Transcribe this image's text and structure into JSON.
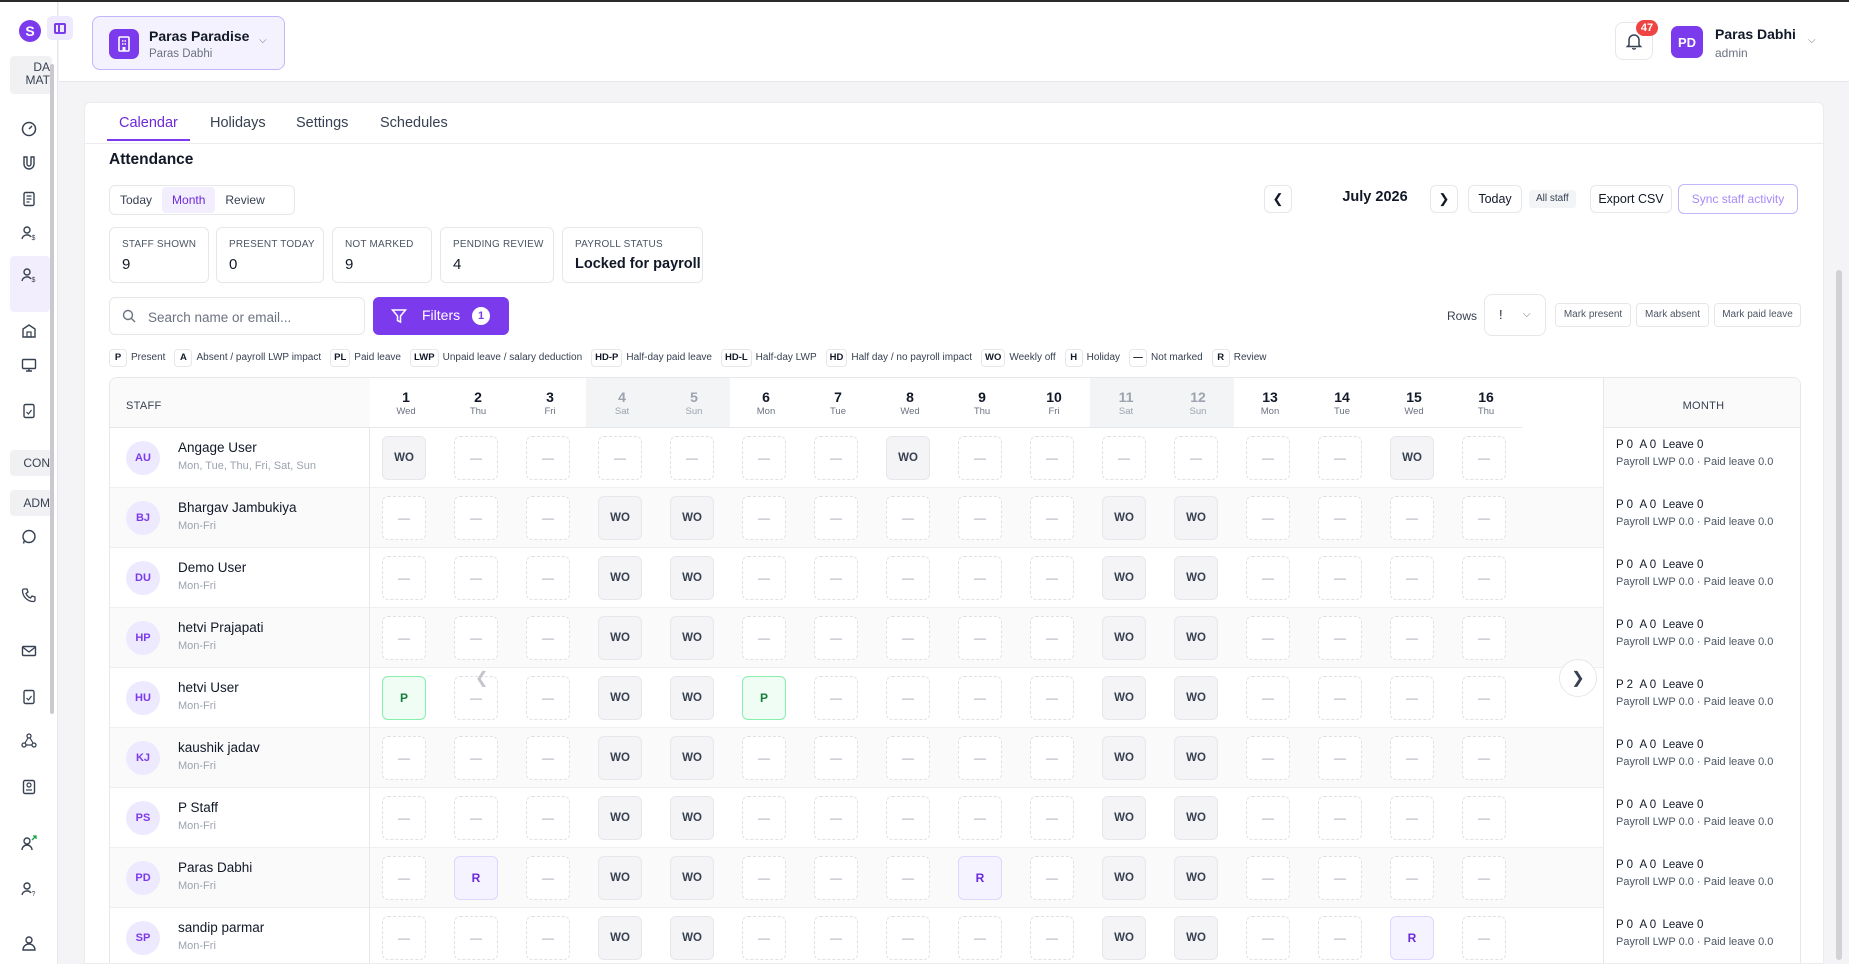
{
  "property": {
    "name": "Paras Paradise",
    "owner": "Paras Dabhi"
  },
  "user": {
    "initials": "PD",
    "name": "Paras Dabhi",
    "role": "admin",
    "notifications": "47"
  },
  "sidebar": {
    "logo": "S",
    "groups": [
      "DA MAT",
      "CON",
      "ADM"
    ]
  },
  "tabs": [
    "Calendar",
    "Holidays",
    "Settings",
    "Schedules"
  ],
  "title": "Attendance",
  "view_modes": [
    "Today",
    "Month",
    "Review"
  ],
  "stats": [
    {
      "label": "STAFF SHOWN",
      "value": "9"
    },
    {
      "label": "PRESENT TODAY",
      "value": "0"
    },
    {
      "label": "NOT MARKED",
      "value": "9"
    },
    {
      "label": "PENDING REVIEW",
      "value": "4"
    },
    {
      "label": "PAYROLL STATUS",
      "value": "Locked for payroll"
    }
  ],
  "calendar_nav": {
    "month": "July 2026",
    "today": "Today",
    "all_staff": "All staff",
    "export": "Export CSV",
    "sync": "Sync staff activity"
  },
  "search": {
    "placeholder": "Search name or email..."
  },
  "filters": {
    "label": "Filters",
    "count": "1"
  },
  "rows": {
    "label": "Rows",
    "value": "!"
  },
  "mark_buttons": [
    "Mark present",
    "Mark absent",
    "Mark paid leave"
  ],
  "legend": [
    {
      "code": "P",
      "text": "Present"
    },
    {
      "code": "A",
      "text": "Absent / payroll LWP impact"
    },
    {
      "code": "PL",
      "text": "Paid leave"
    },
    {
      "code": "LWP",
      "text": "Unpaid leave / salary deduction"
    },
    {
      "code": "HD-P",
      "text": "Half-day paid leave"
    },
    {
      "code": "HD-L",
      "text": "Half-day LWP"
    },
    {
      "code": "HD",
      "text": "Half day / no payroll impact"
    },
    {
      "code": "WO",
      "text": "Weekly off"
    },
    {
      "code": "H",
      "text": "Holiday"
    },
    {
      "code": "—",
      "text": "Not marked"
    },
    {
      "code": "R",
      "text": "Review"
    }
  ],
  "grid": {
    "staff_header": "STAFF",
    "month_header": "MONTH",
    "days": [
      {
        "n": "1",
        "w": "Wed"
      },
      {
        "n": "2",
        "w": "Thu"
      },
      {
        "n": "3",
        "w": "Fri"
      },
      {
        "n": "4",
        "w": "Sat"
      },
      {
        "n": "5",
        "w": "Sun"
      },
      {
        "n": "6",
        "w": "Mon"
      },
      {
        "n": "7",
        "w": "Tue"
      },
      {
        "n": "8",
        "w": "Wed"
      },
      {
        "n": "9",
        "w": "Thu"
      },
      {
        "n": "10",
        "w": "Fri"
      },
      {
        "n": "11",
        "w": "Sat"
      },
      {
        "n": "12",
        "w": "Sun"
      },
      {
        "n": "13",
        "w": "Mon"
      },
      {
        "n": "14",
        "w": "Tue"
      },
      {
        "n": "15",
        "w": "Wed"
      },
      {
        "n": "16",
        "w": "Thu"
      }
    ],
    "staff": [
      {
        "initials": "AU",
        "name": "Angage User",
        "schedule": "Mon, Tue, Thu, Fri, Sat, Sun",
        "cells": [
          "WO",
          "—",
          "—",
          "—",
          "—",
          "—",
          "—",
          "WO",
          "—",
          "—",
          "—",
          "—",
          "—",
          "—",
          "WO",
          "—"
        ],
        "p": "0",
        "a": "0",
        "leave": "0",
        "payroll_lwp": "0.0",
        "paid_leave": "0.0"
      },
      {
        "initials": "BJ",
        "name": "Bhargav Jambukiya",
        "schedule": "Mon-Fri",
        "cells": [
          "—",
          "—",
          "—",
          "WO",
          "WO",
          "—",
          "—",
          "—",
          "—",
          "—",
          "WO",
          "WO",
          "—",
          "—",
          "—",
          "—"
        ],
        "p": "0",
        "a": "0",
        "leave": "0",
        "payroll_lwp": "0.0",
        "paid_leave": "0.0"
      },
      {
        "initials": "DU",
        "name": "Demo User",
        "schedule": "Mon-Fri",
        "cells": [
          "—",
          "—",
          "—",
          "WO",
          "WO",
          "—",
          "—",
          "—",
          "—",
          "—",
          "WO",
          "WO",
          "—",
          "—",
          "—",
          "—"
        ],
        "p": "0",
        "a": "0",
        "leave": "0",
        "payroll_lwp": "0.0",
        "paid_leave": "0.0"
      },
      {
        "initials": "HP",
        "name": "hetvi Prajapati",
        "schedule": "Mon-Fri",
        "cells": [
          "—",
          "—",
          "—",
          "WO",
          "WO",
          "—",
          "—",
          "—",
          "—",
          "—",
          "WO",
          "WO",
          "—",
          "—",
          "—",
          "—"
        ],
        "p": "0",
        "a": "0",
        "leave": "0",
        "payroll_lwp": "0.0",
        "paid_leave": "0.0"
      },
      {
        "initials": "HU",
        "name": "hetvi User",
        "schedule": "Mon-Fri",
        "cells": [
          "P",
          "—",
          "—",
          "WO",
          "WO",
          "P",
          "—",
          "—",
          "—",
          "—",
          "WO",
          "WO",
          "—",
          "—",
          "—",
          "—"
        ],
        "p": "2",
        "a": "0",
        "leave": "0",
        "payroll_lwp": "0.0",
        "paid_leave": "0.0"
      },
      {
        "initials": "KJ",
        "name": "kaushik jadav",
        "schedule": "Mon-Fri",
        "cells": [
          "—",
          "—",
          "—",
          "WO",
          "WO",
          "—",
          "—",
          "—",
          "—",
          "—",
          "WO",
          "WO",
          "—",
          "—",
          "—",
          "—"
        ],
        "p": "0",
        "a": "0",
        "leave": "0",
        "payroll_lwp": "0.0",
        "paid_leave": "0.0"
      },
      {
        "initials": "PS",
        "name": "P Staff",
        "schedule": "Mon-Fri",
        "cells": [
          "—",
          "—",
          "—",
          "WO",
          "WO",
          "—",
          "—",
          "—",
          "—",
          "—",
          "WO",
          "WO",
          "—",
          "—",
          "—",
          "—"
        ],
        "p": "0",
        "a": "0",
        "leave": "0",
        "payroll_lwp": "0.0",
        "paid_leave": "0.0"
      },
      {
        "initials": "PD",
        "name": "Paras Dabhi",
        "schedule": "Mon-Fri",
        "cells": [
          "—",
          "R",
          "—",
          "WO",
          "WO",
          "—",
          "—",
          "—",
          "R",
          "—",
          "WO",
          "WO",
          "—",
          "—",
          "—",
          "—"
        ],
        "p": "0",
        "a": "0",
        "leave": "0",
        "payroll_lwp": "0.0",
        "paid_leave": "0.0"
      },
      {
        "initials": "SP",
        "name": "sandip parmar",
        "schedule": "Mon-Fri",
        "cells": [
          "—",
          "—",
          "—",
          "WO",
          "WO",
          "—",
          "—",
          "—",
          "—",
          "—",
          "WO",
          "WO",
          "—",
          "—",
          "R",
          "—"
        ],
        "p": "0",
        "a": "0",
        "leave": "0",
        "payroll_lwp": "0.0",
        "paid_leave": "0.0"
      }
    ]
  },
  "colors": {
    "accent": "#7c3aed",
    "present": "#15803d",
    "notification": "#ef4444"
  }
}
